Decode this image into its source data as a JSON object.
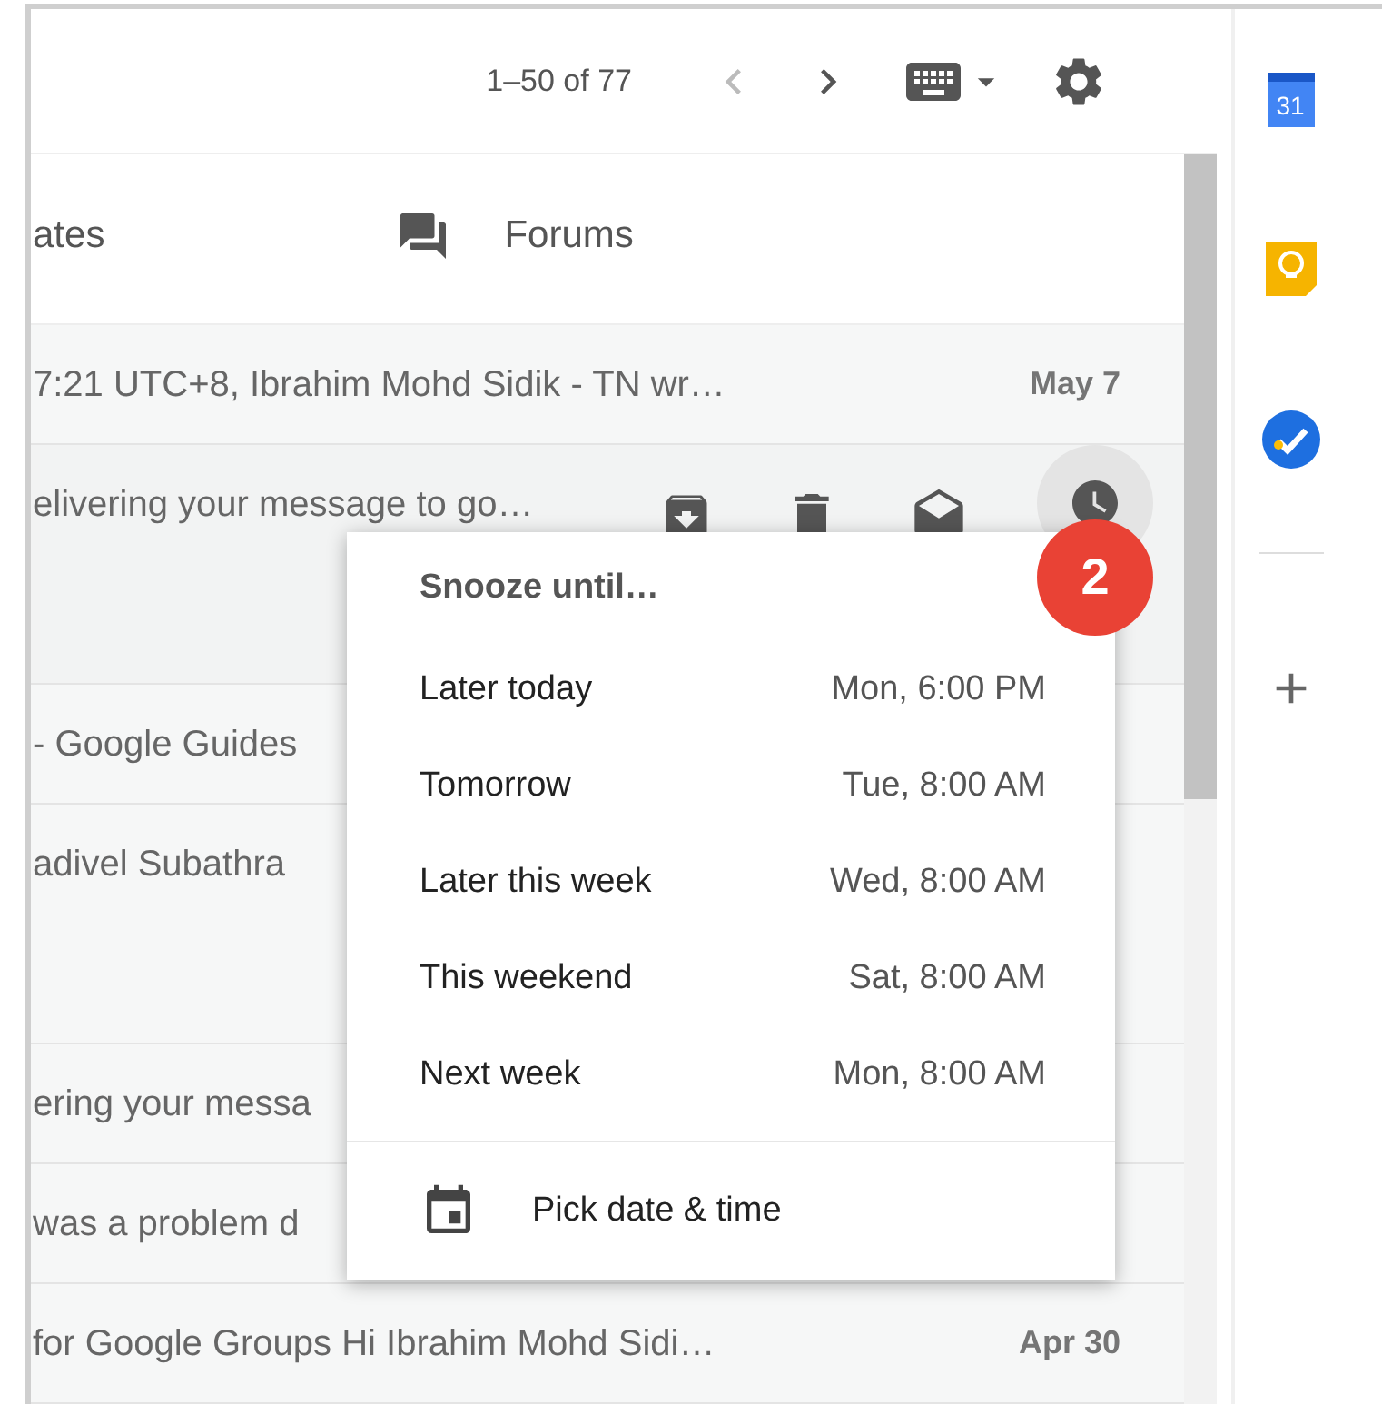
{
  "toolbar": {
    "page_range": "1–50 of 77"
  },
  "tabs": [
    {
      "label": "ates",
      "selected": false
    },
    {
      "label": "Forums",
      "selected": false
    }
  ],
  "emails": [
    {
      "snippet": "7:21 UTC+8, Ibrahim Mohd Sidik - TN wr…",
      "date": "May 7",
      "kind": "plain",
      "hovered": false
    },
    {
      "snippet": "elivering your message to go…",
      "kind": "tall",
      "hovered": true
    },
    {
      "snippet": "- Google Guides",
      "kind": "plain",
      "hovered": false
    },
    {
      "snippet": "adivel Subathra",
      "kind": "tall",
      "hovered": false
    },
    {
      "snippet": "ering your messa",
      "kind": "plain",
      "hovered": false
    },
    {
      "snippet": "was a problem d",
      "kind": "plain",
      "hovered": false
    },
    {
      "snippet": "for Google Groups Hi Ibrahim Mohd Sidi…",
      "date": "Apr 30",
      "kind": "plain",
      "hovered": false
    }
  ],
  "snooze_menu": {
    "title": "Snooze until…",
    "options": [
      {
        "label": "Later today",
        "time": "Mon, 6:00 PM"
      },
      {
        "label": "Tomorrow",
        "time": "Tue, 8:00 AM"
      },
      {
        "label": "Later this week",
        "time": "Wed, 8:00 AM"
      },
      {
        "label": "This weekend",
        "time": "Sat, 8:00 AM"
      },
      {
        "label": "Next week",
        "time": "Mon, 8:00 AM"
      }
    ],
    "custom": "Pick date & time"
  },
  "step_badge": "2",
  "side_panel": {
    "calendar_day": "31",
    "apps": [
      {
        "kind": "calendar"
      },
      {
        "kind": "keep"
      },
      {
        "kind": "tasks"
      }
    ]
  }
}
